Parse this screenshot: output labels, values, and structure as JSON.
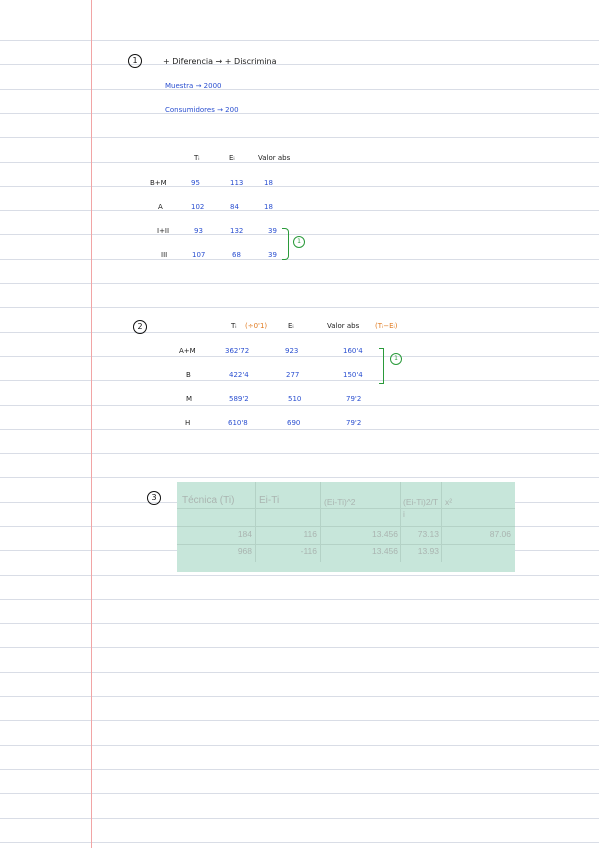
{
  "colors": {
    "ink_black": "#222222",
    "ink_blue": "#2a4fd0",
    "ink_orange": "#e07a1f",
    "ink_green": "#2a9a3a",
    "sheet_bg": "#c7e6da"
  },
  "section1": {
    "number": "1",
    "heading": "+ Diferencia → + Discrimina",
    "muestra": "Muestra → 2000",
    "consumidores": "Consumidores → 200",
    "headers": {
      "ti": "Tᵢ",
      "ei": "Eᵢ",
      "valor": "Valor abs"
    },
    "rows": [
      {
        "label": "B+M",
        "ti": "95",
        "ei": "113",
        "abs": "18"
      },
      {
        "label": "A",
        "ti": "102",
        "ei": "84",
        "abs": "18"
      },
      {
        "label": "I+II",
        "ti": "93",
        "ei": "132",
        "abs": "39"
      },
      {
        "label": "III",
        "ti": "107",
        "ei": "68",
        "abs": "39"
      }
    ],
    "note": "1"
  },
  "section2": {
    "number": "2",
    "headers": {
      "ti": "Tᵢ",
      "ti_note": "(÷0'1)",
      "ei": "Eᵢ",
      "valor": "Valor abs",
      "valor_note": "(Tᵢ−Eᵢ)"
    },
    "rows": [
      {
        "label": "A+M",
        "ti": "362'72",
        "ei": "923",
        "abs": "160'4"
      },
      {
        "label": "B",
        "ti": "422'4",
        "ei": "277",
        "abs": "150'4"
      },
      {
        "label": "M",
        "ti": "589'2",
        "ei": "510",
        "abs": "79'2"
      },
      {
        "label": "H",
        "ti": "610'8",
        "ei": "690",
        "abs": "79'2"
      }
    ],
    "note": "1"
  },
  "section3": {
    "number": "3",
    "table": {
      "headers": [
        "Técnica (Ti)",
        "Ei-Ti",
        "(Ei-Ti)^2",
        "(Ei-Ti)2/Ti",
        "x²"
      ],
      "rows": [
        [
          "184",
          "116",
          "13.456",
          "73.13",
          "87.06"
        ],
        [
          "968",
          "-116",
          "13.456",
          "13.93",
          ""
        ]
      ]
    }
  }
}
